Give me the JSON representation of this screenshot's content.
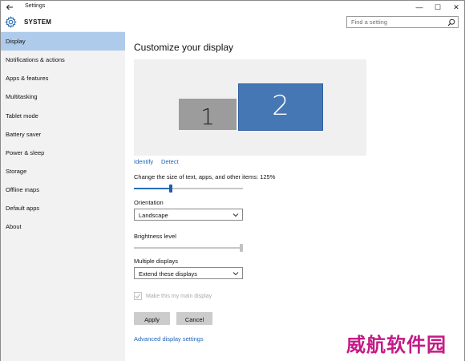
{
  "window": {
    "title": "Settings",
    "back_icon": "arrow-left-icon",
    "minimize_glyph": "—",
    "maximize_glyph": "☐",
    "close_glyph": "✕"
  },
  "header": {
    "icon": "gear-icon",
    "title": "SYSTEM",
    "search_placeholder": "Find a setting"
  },
  "sidebar": {
    "items": [
      {
        "label": "Display",
        "active": true
      },
      {
        "label": "Notifications & actions",
        "active": false
      },
      {
        "label": "Apps & features",
        "active": false
      },
      {
        "label": "Multitasking",
        "active": false
      },
      {
        "label": "Tablet mode",
        "active": false
      },
      {
        "label": "Battery saver",
        "active": false
      },
      {
        "label": "Power & sleep",
        "active": false
      },
      {
        "label": "Storage",
        "active": false
      },
      {
        "label": "Offline maps",
        "active": false
      },
      {
        "label": "Default apps",
        "active": false
      },
      {
        "label": "About",
        "active": false
      }
    ]
  },
  "main": {
    "title": "Customize your display",
    "monitors": [
      {
        "number": "1",
        "selected": false
      },
      {
        "number": "2",
        "selected": true
      }
    ],
    "identify_link": "Identify",
    "detect_link": "Detect",
    "scale_label": "Change the size of text, apps, and other items: 125%",
    "scale_value": 0.33,
    "orientation_label": "Orientation",
    "orientation_value": "Landscape",
    "brightness_label": "Brightness level",
    "brightness_value": 1.0,
    "multiple_displays_label": "Multiple displays",
    "multiple_displays_value": "Extend these displays",
    "main_display_label": "Make this my main display",
    "main_display_checked": true,
    "main_display_enabled": false,
    "apply_button": "Apply",
    "cancel_button": "Cancel",
    "advanced_link": "Advanced display settings"
  },
  "watermark": {
    "text": "威航软件园"
  },
  "colors": {
    "accent": "#1d64b8",
    "sidebar_bg": "#f2f2f2",
    "active_item": "#aecbeb",
    "monitor_selected": "#4677b5",
    "monitor_other": "#9c9c9c",
    "slider_blue": "#2a6db7",
    "watermark": "#c41a86"
  }
}
